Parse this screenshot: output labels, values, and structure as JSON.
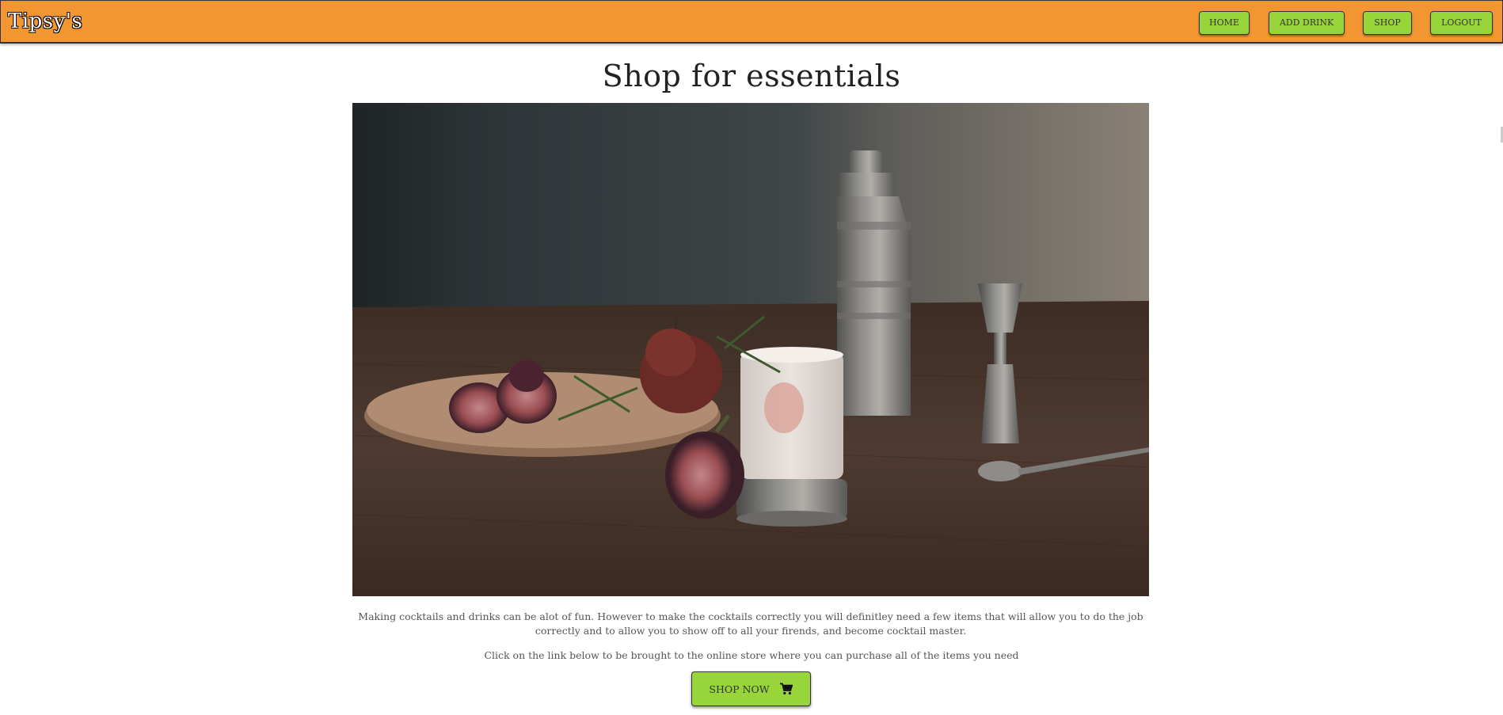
{
  "header": {
    "brand": "Tipsy's",
    "nav": [
      {
        "label": "HOME"
      },
      {
        "label": "ADD DRINK"
      },
      {
        "label": "SHOP"
      },
      {
        "label": "LOGOUT"
      }
    ]
  },
  "main": {
    "title": "Shop for essentials",
    "intro": "Making cocktails and drinks can be alot of fun. However to make the cocktails correctly you will definitley need a few items that will allow you to do the job correctly and to allow you to show off to all your firends, and become cocktail master.",
    "cta_text": "Click on the link below to be brought to the online store where you can purchase all of the items you need",
    "shop_button": {
      "label": "SHOP NOW",
      "icon": "cart-icon"
    }
  },
  "colors": {
    "header_bg": "#f29632",
    "button_bg": "#97d53a"
  }
}
